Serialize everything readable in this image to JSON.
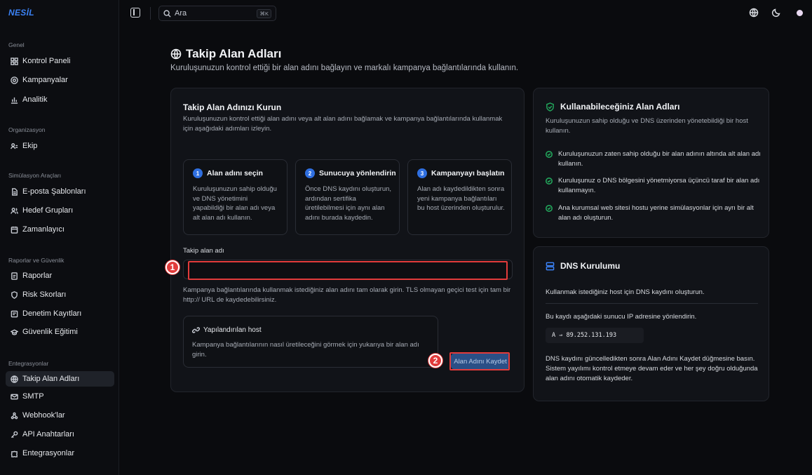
{
  "brand": "NESİL",
  "search": {
    "placeholder": "Ara",
    "shortcut": "⌘K"
  },
  "sidebar": {
    "sections": [
      {
        "title": "Genel",
        "items": [
          "Kontrol Paneli",
          "Kampanyalar",
          "Analitik"
        ]
      },
      {
        "title": "Organizasyon",
        "items": [
          "Ekip"
        ]
      },
      {
        "title": "Simülasyon Araçları",
        "items": [
          "E-posta Şablonları",
          "Hedef Grupları",
          "Zamanlayıcı"
        ]
      },
      {
        "title": "Raporlar ve Güvenlik",
        "items": [
          "Raporlar",
          "Risk Skorları",
          "Denetim Kayıtları",
          "Güvenlik Eğitimi"
        ]
      },
      {
        "title": "Entegrasyonlar",
        "items": [
          "Takip Alan Adları",
          "SMTP",
          "Webhook'lar",
          "API Anahtarları",
          "Entegrasyonlar"
        ]
      }
    ],
    "active_item": "Takip Alan Adları"
  },
  "header": {
    "title": "Takip Alan Adları",
    "subtitle": "Kuruluşunuzun kontrol ettiği bir alan adını bağlayın ve markalı kampanya bağlantılarında kullanın."
  },
  "setup": {
    "title": "Takip Alan Adınızı Kurun",
    "description": "Kuruluşunuzun kontrol ettiği alan adını veya alt alan adını bağlamak ve kampanya bağlantılarında kullanmak için aşağıdaki adımları izleyin.",
    "steps": [
      {
        "number": "1",
        "title": "Alan adını seçin",
        "body": "Kuruluşunuzun sahip olduğu ve DNS yönetimini yapabildiği bir alan adı veya alt alan adı kullanın."
      },
      {
        "number": "2",
        "title": "Sunucuya yönlendirin",
        "body": "Önce DNS kaydını oluşturun, ardından sertifika üretilebilmesi için aynı alan adını burada kaydedin."
      },
      {
        "number": "3",
        "title": "Kampanyayı başlatın",
        "body": "Alan adı kaydedildikten sonra yeni kampanya bağlantıları bu host üzerinden oluşturulur."
      }
    ],
    "field_label": "Takip alan adı",
    "field_value": "",
    "field_help": "Kampanya bağlantılarında kullanmak istediğiniz alan adını tam olarak girin. TLS olmayan geçici test için tam bir http:// URL de kaydedebilirsiniz.",
    "host_title": "Yapılandırılan host",
    "host_desc": "Kampanya bağlantılarının nasıl üretileceğini görmek için yukarıya bir alan adı girin.",
    "save_label": "Alan Adını Kaydet"
  },
  "available": {
    "title": "Kullanabileceğiniz Alan Adları",
    "description": "Kuruluşunuzun sahip olduğu ve DNS üzerinden yönetebildiği bir host kullanın.",
    "bullets": [
      "Kuruluşunuzun zaten sahip olduğu bir alan adının altında alt alan adı kullanın.",
      "Kuruluşunuz o DNS bölgesini yönetmiyorsa üçüncü taraf bir alan adı kullanmayın.",
      "Ana kurumsal web sitesi hostu yerine simülasyonlar için ayrı bir alt alan adı oluşturun."
    ]
  },
  "dns": {
    "title": "DNS Kurulumu",
    "line1": "Kullanmak istediğiniz host için DNS kaydını oluşturun.",
    "line2": "Bu kaydı aşağıdaki sunucu IP adresine yönlendirin.",
    "record": "A ⇒ 89.252.131.193",
    "note": "DNS kaydını güncelledikten sonra Alan Adını Kaydet düğmesine basın. Sistem yayılımı kontrol etmeye devam eder ve her şey doğru olduğunda alan adını otomatik kaydeder."
  },
  "annotations": {
    "marker1": "1",
    "marker2": "2"
  },
  "colors": {
    "accent": "#2f6fe0",
    "highlight": "#e23b3b",
    "success": "#22a55b"
  }
}
